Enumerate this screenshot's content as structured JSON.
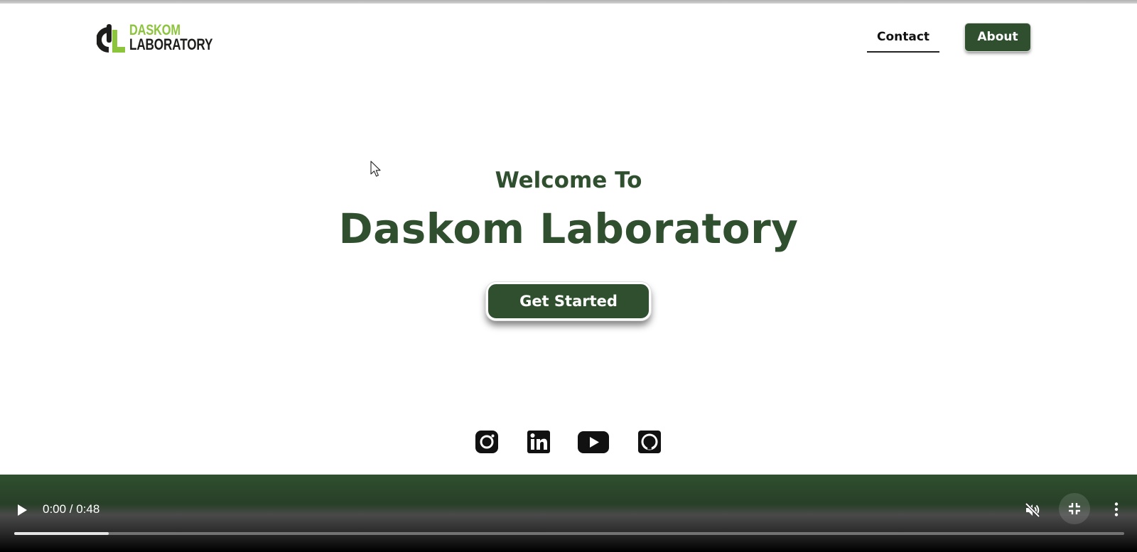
{
  "header": {
    "logo": {
      "line1": "DASKOM",
      "line2": "LABORATORY",
      "accent_color": "#8cc43c",
      "dark_color": "#1d1d1b"
    },
    "nav": {
      "contact_label": "Contact",
      "about_label": "About"
    }
  },
  "hero": {
    "welcome": "Welcome To",
    "title": "Daskom Laboratory",
    "cta_label": "Get Started",
    "brand_color": "#2f4f2f"
  },
  "social": [
    {
      "name": "instagram-icon"
    },
    {
      "name": "linkedin-icon"
    },
    {
      "name": "youtube-icon"
    },
    {
      "name": "github-icon"
    }
  ],
  "video_controls": {
    "time": "0:00 / 0:48",
    "progress_fraction": 0.085,
    "icons": [
      "play-icon",
      "muted-volume-icon",
      "exit-fullscreen-icon",
      "more-options-icon"
    ]
  }
}
